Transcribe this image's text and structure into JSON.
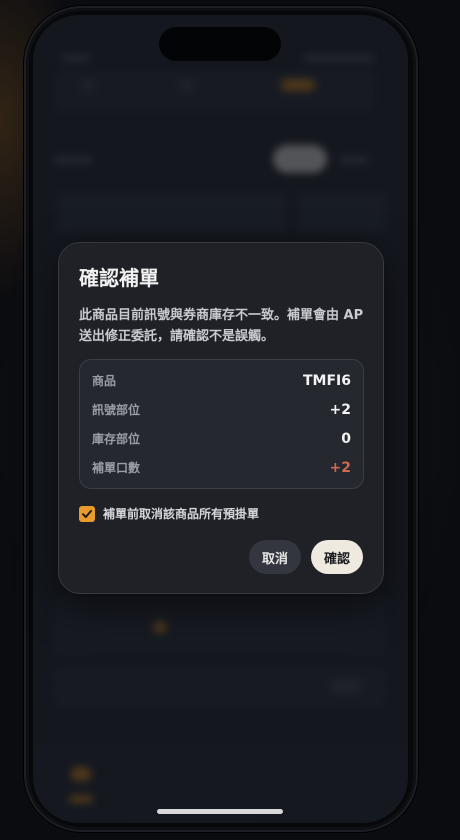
{
  "dialog": {
    "title": "確認補單",
    "message": "此商品目前訊號與券商庫存不一致。補單會由 AP 送出修正委託，請確認不是誤觸。",
    "rows": [
      {
        "label": "商品",
        "value": "TMFI6"
      },
      {
        "label": "訊號部位",
        "value": "+2"
      },
      {
        "label": "庫存部位",
        "value": "0"
      },
      {
        "label": "補單口數",
        "value": "+2"
      }
    ],
    "cancel_all_pending": {
      "label": "補單前取消該商品所有預掛單",
      "checked": true
    },
    "buttons": {
      "cancel": "取消",
      "confirm": "確認"
    }
  },
  "colors": {
    "accent_orange": "#e89a2c",
    "accent_red": "#d06a4e",
    "dialog_bg": "#1f2127"
  }
}
